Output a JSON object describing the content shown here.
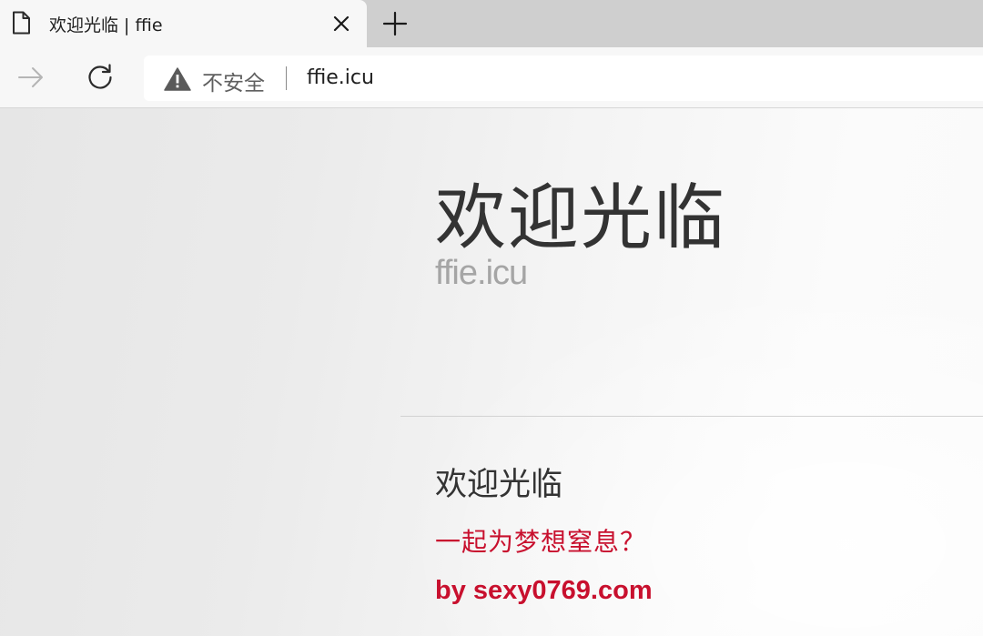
{
  "tab": {
    "title": "欢迎光临 | ffie",
    "page_icon": "page-icon",
    "close_icon": "close-icon"
  },
  "new_tab_icon": "plus-icon",
  "toolbar": {
    "forward_icon": "arrow-right-icon",
    "refresh_icon": "refresh-icon"
  },
  "addressbar": {
    "warning_icon": "warning-icon",
    "security_label": "不安全",
    "url": "ffie.icu"
  },
  "page": {
    "hero_title": "欢迎光临",
    "hero_domain": "ffie.icu",
    "section_title": "欢迎光临",
    "tagline": "一起为梦想窒息？",
    "byline": "by sexy0769.com"
  },
  "colors": {
    "accent_red": "#c8102e",
    "heading": "#333333",
    "muted": "#a5a5a5"
  }
}
